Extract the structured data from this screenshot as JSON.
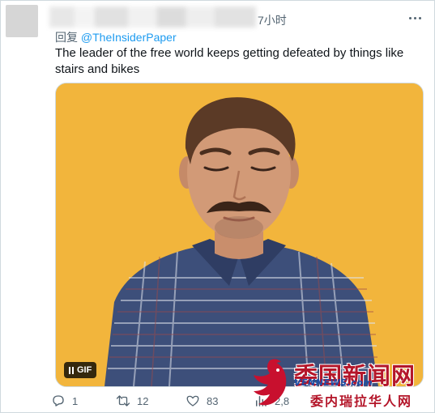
{
  "tweet": {
    "time": "7小时",
    "reply_prefix": "回复",
    "reply_to": "@TheInsiderPaper",
    "text": "The leader of the free world keeps getting defeated by things like stairs and bikes"
  },
  "media": {
    "badge_label": "GIF",
    "background_color": "#f2b53c"
  },
  "actions": {
    "reply_count": "1",
    "retweet_count": "12",
    "like_count": "83",
    "views_count": "2,8"
  },
  "watermark": {
    "line1": "委国新闻网",
    "line2": "VENNEWS.com",
    "line3": "委内瑞拉华人网"
  },
  "icons": {
    "more": "more-icon",
    "reply": "reply-icon",
    "retweet": "retweet-icon",
    "like": "heart-icon",
    "views": "views-icon",
    "pause": "pause-icon"
  },
  "colors": {
    "link": "#1d9bf0",
    "secondary_text": "#536471",
    "watermark_red": "#b4162a",
    "watermark_blue": "#1d4fa8"
  }
}
